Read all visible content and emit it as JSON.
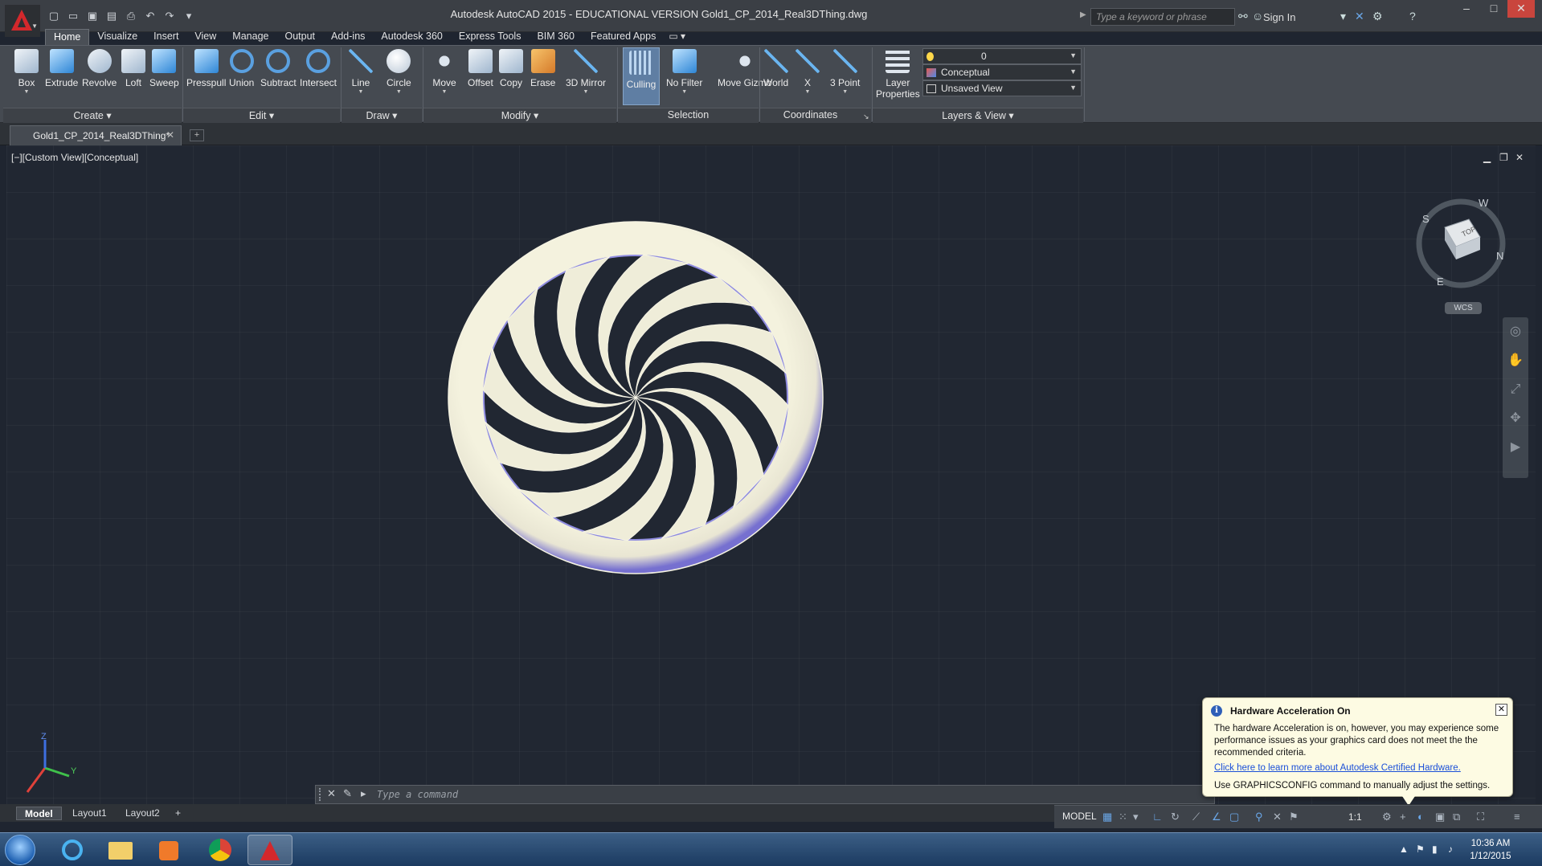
{
  "titlebar": {
    "title": "Autodesk AutoCAD 2015 - EDUCATIONAL VERSION      Gold1_CP_2014_Real3DThing.dwg",
    "search_placeholder": "Type a keyword or phrase",
    "sign_in": "Sign In"
  },
  "ribbon_tabs": [
    "Home",
    "Visualize",
    "Insert",
    "View",
    "Manage",
    "Output",
    "Add-ins",
    "Autodesk 360",
    "Express Tools",
    "BIM 360",
    "Featured Apps"
  ],
  "ribbon": {
    "create": {
      "label": "Create",
      "tools": [
        "Box",
        "Extrude",
        "Revolve",
        "Loft",
        "Sweep"
      ]
    },
    "edit": {
      "label": "Edit",
      "tools": [
        "Presspull",
        "Union",
        "Subtract",
        "Intersect"
      ]
    },
    "draw": {
      "label": "Draw",
      "tools": [
        "Line",
        "Circle"
      ]
    },
    "modify": {
      "label": "Modify",
      "tools": [
        "Move",
        "Offset",
        "Copy",
        "Erase",
        "3D Mirror"
      ]
    },
    "selection": {
      "label": "Selection",
      "tools": [
        "Culling",
        "No Filter",
        "Move Gizmo"
      ]
    },
    "coordinates": {
      "label": "Coordinates",
      "tools": [
        "World",
        "X",
        "3 Point"
      ]
    },
    "layers_view": {
      "label": "Layers & View",
      "tool": "Layer Properties",
      "layer_value": "0",
      "visual_style": "Conceptual",
      "view": "Unsaved View"
    }
  },
  "document_tab": "Gold1_CP_2014_Real3DThing*",
  "viewport": {
    "label": "[−][Custom View][Conceptual]",
    "viewcube_face": "TOP",
    "compass": [
      "S",
      "W",
      "N",
      "E"
    ],
    "wcs": "WCS",
    "ucs_axes": [
      "Z",
      "Y"
    ]
  },
  "command_line": {
    "placeholder": "Type a command"
  },
  "notification": {
    "title": "Hardware Acceleration On",
    "body": "The hardware Acceleration is on, however, you may experience some performance issues as your graphics card does not meet the the recommended criteria.",
    "link": "Click here to learn more about  Autodesk Certified Hardware.",
    "footer": "Use GRAPHICSCONFIG command to manually adjust the settings."
  },
  "layout_tabs": [
    "Model",
    "Layout1",
    "Layout2"
  ],
  "status_bar": {
    "mode": "MODEL",
    "scale": "1:1"
  },
  "taskbar": {
    "time": "10:36 AM",
    "date": "1/12/2015"
  },
  "colors": {
    "ribbon": "#454a51",
    "viewport": "#212732",
    "model": "#efedd9",
    "model_shade": "#6a62c4",
    "notification": "#fdfbe3"
  }
}
